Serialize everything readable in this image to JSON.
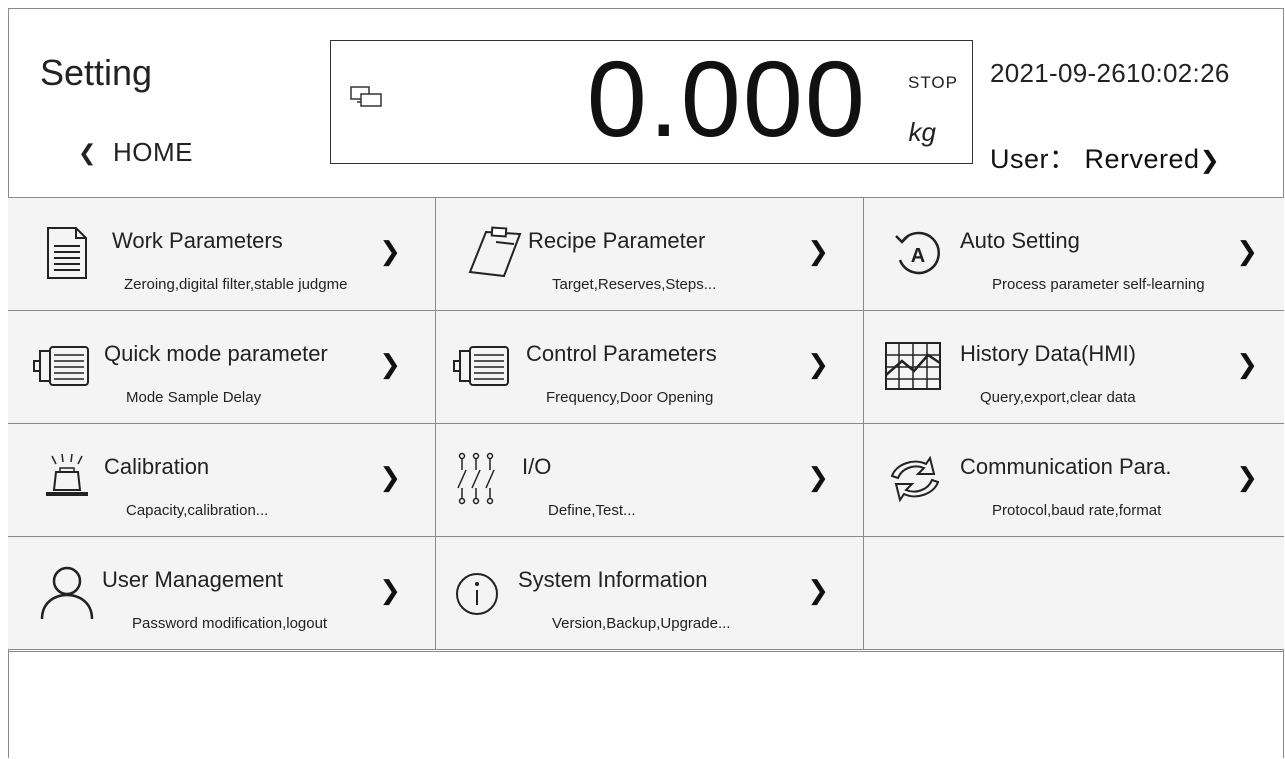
{
  "header": {
    "title": "Setting",
    "home_label": "HOME",
    "home_chevron": "❮",
    "datetime": "2021-09-2610:02:26",
    "user_label": "User： Rervered",
    "user_chevron": "❯"
  },
  "weight": {
    "value": "0.000",
    "status": "STOP",
    "unit": "kg"
  },
  "tiles": [
    {
      "title": "Work Parameters",
      "subtitle": "Zeroing,digital filter,stable judgme",
      "icon": "document-icon"
    },
    {
      "title": "Recipe Parameter",
      "subtitle": "Target,Reserves,Steps...",
      "icon": "clipboard-icon"
    },
    {
      "title": "Auto Setting",
      "subtitle": "Process parameter self-learning",
      "icon": "auto-a-icon"
    },
    {
      "title": "Quick mode parameter",
      "subtitle": "Mode Sample Delay",
      "icon": "motor-icon"
    },
    {
      "title": "Control Parameters",
      "subtitle": "Frequency,Door Opening",
      "icon": "motor-icon"
    },
    {
      "title": "History Data(HMI)",
      "subtitle": "Query,export,clear data",
      "icon": "chart-grid-icon"
    },
    {
      "title": "Calibration",
      "subtitle": "Capacity,calibration...",
      "icon": "weight-icon"
    },
    {
      "title": "I/O",
      "subtitle": "Define,Test...",
      "icon": "switch-icon"
    },
    {
      "title": "Communication Para.",
      "subtitle": "Protocol,baud rate,format",
      "icon": "sync-arrows-icon"
    },
    {
      "title": "User Management",
      "subtitle": "Password modification,logout",
      "icon": "user-icon"
    },
    {
      "title": "System Information",
      "subtitle": "Version,Backup,Upgrade...",
      "icon": "info-icon"
    }
  ],
  "arrow": "❯"
}
